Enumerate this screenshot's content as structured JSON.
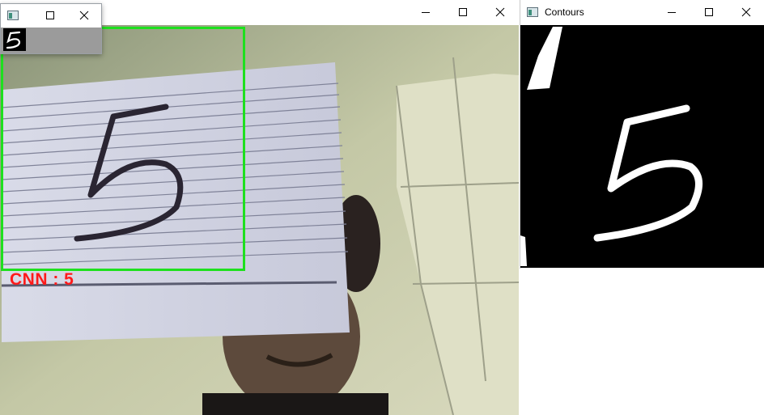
{
  "main_window": {
    "title": "",
    "prediction_label": "CNN : 5",
    "roi_color": "#1ee01e",
    "prediction_color": "#ff1a1a"
  },
  "contours_window": {
    "title": "Contours"
  },
  "digit_window": {
    "title": ""
  },
  "card": {
    "digit": "5"
  },
  "icons": {
    "minimize": "minimize-icon",
    "maximize": "maximize-icon",
    "close": "close-icon",
    "app": "app-icon"
  }
}
